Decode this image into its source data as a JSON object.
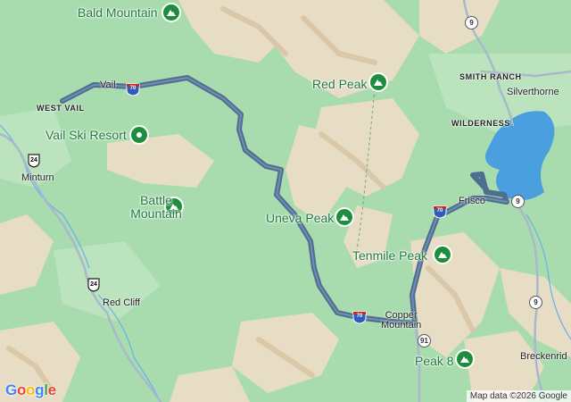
{
  "map": {
    "colors": {
      "forest": "#a8dcae",
      "alpine": "#e7dcc4",
      "ridge": "#d8c3a0",
      "water": "#4a9fde",
      "route": "#4f6d8f",
      "road": "#a9b8cc"
    },
    "peaks": [
      {
        "name": "Bald Mountain",
        "icon": "mountain-icon"
      },
      {
        "name": "Red Peak",
        "icon": "mountain-icon"
      },
      {
        "name": "Battle Mountain",
        "icon": "mountain-icon"
      },
      {
        "name": "Uneva Peak",
        "icon": "mountain-icon"
      },
      {
        "name": "Tenmile Peak",
        "icon": "mountain-icon"
      },
      {
        "name": "Peak 8",
        "icon": "mountain-icon"
      }
    ],
    "resort": {
      "name": "Vail Ski Resort",
      "icon": "ski-resort-icon"
    },
    "places": {
      "vail": "Vail",
      "west_vail": "WEST VAIL",
      "minturn": "Minturn",
      "red_cliff": "Red Cliff",
      "smith_ranch": "SMITH RANCH",
      "silverthorne": "Silverthorne",
      "wilderness": "WILDERNESS",
      "frisco": "Frisco",
      "copper_mountain": "Copper\nMountain",
      "breckenridge": "Breckenrid"
    },
    "shields": {
      "i70_a": "70",
      "i70_b": "70",
      "i70_c": "70",
      "us24_a": "24",
      "us24_b": "24",
      "co9_a": "9",
      "co9_b": "9",
      "co9_c": "9",
      "co91": "91"
    },
    "attribution": "Map data ©2026 Google",
    "logo": [
      "G",
      "o",
      "o",
      "g",
      "l",
      "e"
    ]
  }
}
